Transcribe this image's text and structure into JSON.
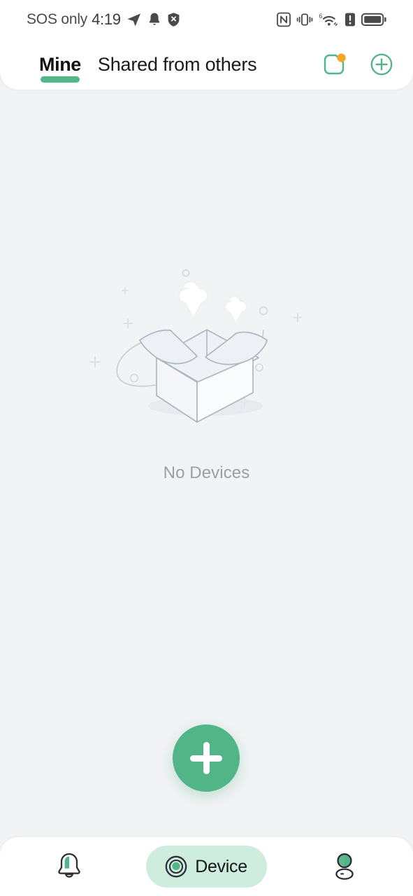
{
  "status_bar": {
    "carrier": "SOS only",
    "time": "4:19",
    "left_icons": [
      "send-icon",
      "bell-icon",
      "shield-off-icon"
    ],
    "right_icons": [
      "nfc-icon",
      "vibrate-icon",
      "wifi-6-icon",
      "alert-icon",
      "battery-icon"
    ],
    "wifi_generation": "6",
    "battery_level": 85
  },
  "header": {
    "tabs": [
      {
        "label": "Mine",
        "active": true
      },
      {
        "label": "Shared from others",
        "active": false
      }
    ],
    "actions": [
      {
        "name": "files-icon",
        "badge": true,
        "badge_color": "#F5A623"
      },
      {
        "name": "add-circle-icon",
        "badge": false
      }
    ]
  },
  "main": {
    "illustration": "empty-box-illustration",
    "empty_message": "No Devices"
  },
  "fab": {
    "name": "add-device-fab",
    "icon": "plus-icon",
    "color": "#52B587"
  },
  "bottom_nav": {
    "items": [
      {
        "label": "",
        "icon": "bell-icon",
        "active": false
      },
      {
        "label": "Device",
        "icon": "camera-lens-icon",
        "active": true
      },
      {
        "label": "",
        "icon": "profile-icon",
        "active": false
      }
    ]
  },
  "colors": {
    "accent_green": "#52B587",
    "pill_green": "#CFEDDE",
    "background": "#F2F3F5",
    "card": "#FFFFFF",
    "badge_orange": "#F5A623",
    "muted_text": "#9A9EA6"
  }
}
